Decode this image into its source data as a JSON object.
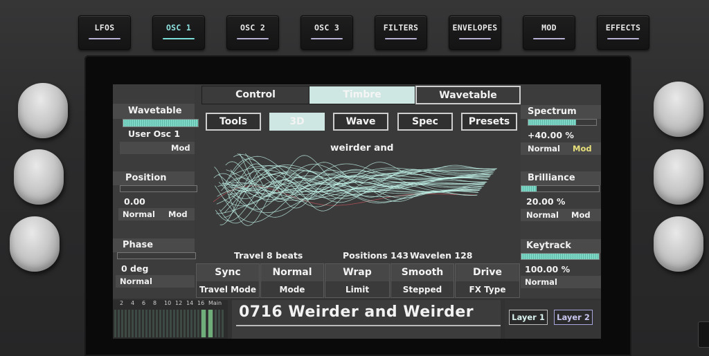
{
  "hardware_buttons": [
    {
      "label": "LFOS",
      "active": false
    },
    {
      "label": "OSC 1",
      "active": true
    },
    {
      "label": "OSC 2",
      "active": false
    },
    {
      "label": "OSC 3",
      "active": false
    },
    {
      "label": "FILTERS",
      "active": false
    },
    {
      "label": "ENVELOPES",
      "active": false
    },
    {
      "label": "MOD",
      "active": false
    },
    {
      "label": "EFFECTS",
      "active": false
    }
  ],
  "top_tabs": [
    {
      "label": "Control",
      "selected": false
    },
    {
      "label": "Timbre",
      "selected": true
    },
    {
      "label": "Wavetable",
      "selected": false
    }
  ],
  "sub_tabs": [
    {
      "label": "Tools",
      "selected": false
    },
    {
      "label": "3D",
      "selected": true
    },
    {
      "label": "Wave",
      "selected": false
    },
    {
      "label": "Spec",
      "selected": false
    },
    {
      "label": "Presets",
      "selected": false
    }
  ],
  "left_params": {
    "wavetable": {
      "title": "Wavetable",
      "value": "User Osc 1",
      "mod": "Mod",
      "level": 1.0
    },
    "position": {
      "title": "Position",
      "value": "0.00",
      "mode": "Normal",
      "mod": "Mod",
      "level": 0.0
    },
    "phase": {
      "title": "Phase",
      "value": "0 deg",
      "mode": "Normal",
      "level": 0.0
    }
  },
  "right_params": {
    "spectrum": {
      "title": "Spectrum",
      "value": "+40.00 %",
      "mode": "Normal",
      "mod": "Mod",
      "level": 0.7
    },
    "brilliance": {
      "title": "Brilliance",
      "value": "20.00 %",
      "mode": "Normal",
      "mod": "Mod",
      "level": 0.2
    },
    "keytrack": {
      "title": "Keytrack",
      "value": "100.00 %",
      "mode": "Normal",
      "level": 1.0
    }
  },
  "wave_view": {
    "title": "weirder and",
    "travel": "Travel 8 beats",
    "positions": "Positions 143",
    "wavelen": "Wavelen 128"
  },
  "bottom_params": [
    {
      "value": "Sync",
      "label": "Travel Mode"
    },
    {
      "value": "Normal",
      "label": "Mode"
    },
    {
      "value": "Wrap",
      "label": "Limit"
    },
    {
      "value": "Smooth",
      "label": "Stepped"
    },
    {
      "value": "Drive",
      "label": "FX Type"
    }
  ],
  "meter": {
    "scale": [
      "2",
      "4",
      "6",
      "8",
      "10",
      "12",
      "14",
      "16",
      "Main"
    ]
  },
  "preset_name": "0716 Weirder and Weirder",
  "layers": [
    {
      "label": "Layer 1",
      "selected": true
    },
    {
      "label": "Layer 2",
      "selected": false
    }
  ],
  "colors": {
    "accent": "#7fd7c7",
    "mod_highlight": "#e8e07a",
    "layer2_border": "#a9a6e0"
  }
}
